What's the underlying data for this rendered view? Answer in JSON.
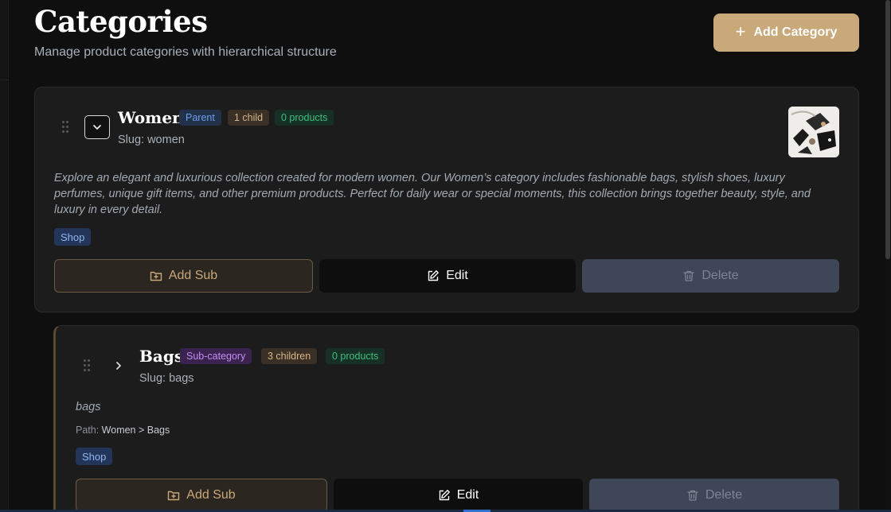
{
  "header": {
    "title": "Categories",
    "subtitle": "Manage product categories with hierarchical structure",
    "add_button_label": "Add Category"
  },
  "categories": [
    {
      "name": "Women",
      "type_badge": "Parent",
      "children_badge": "1 child",
      "products_badge": "0 products",
      "slug": "Slug: women",
      "description": "Explore an elegant and luxurious collection created for modern women. Our Women’s category includes fashionable bags, stylish shoes, luxury perfumes, unique gift items, and other premium products. Perfect for daily wear or special moments, this collection brings together beauty, style, and luxury in every detail.",
      "tag": "Shop",
      "has_image": true,
      "expanded": true
    },
    {
      "name": "Bags",
      "type_badge": "Sub-category",
      "children_badge": "3 children",
      "products_badge": "0 products",
      "slug": "Slug: bags",
      "description": "bags",
      "path_label": "Path:",
      "path_value": "Women > Bags",
      "tag": "Shop",
      "expanded": false
    }
  ],
  "actions": {
    "add_sub": "Add Sub",
    "edit": "Edit",
    "delete": "Delete"
  },
  "icons": {
    "drag": "grip-vertical-icon",
    "chevron_down": "chevron-down-icon",
    "chevron_right": "chevron-right-icon",
    "add_folder": "folder-plus-icon",
    "edit": "square-pen-icon",
    "delete": "trash-icon",
    "plus": "plus-icon"
  },
  "colors": {
    "background": "#0f0f0f",
    "card": "#1c1c1c",
    "accent_gold": "#c9a87a",
    "parent_badge": "#6b9fe6",
    "sub_badge": "#c58cf0",
    "products_badge": "#3fbf7f",
    "delete_bg": "#3e4657"
  }
}
